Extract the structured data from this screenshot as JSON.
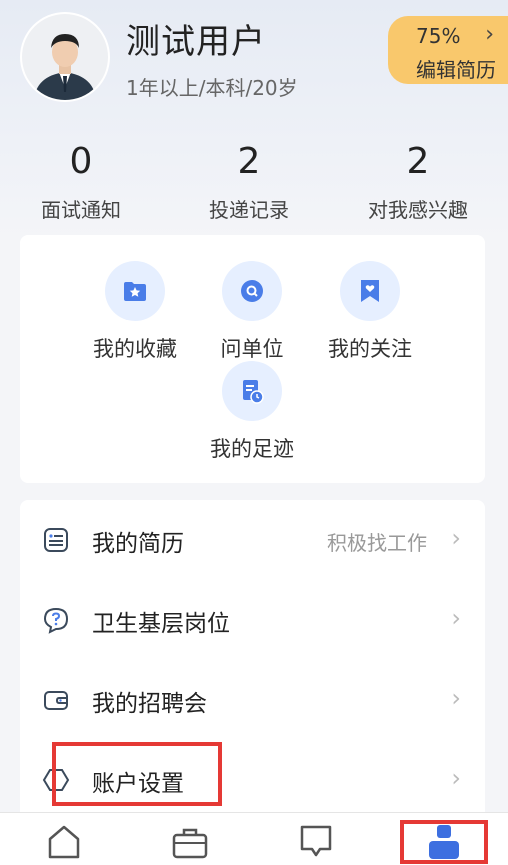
{
  "profile": {
    "name": "测试用户",
    "info": "1年以上/本科/20岁",
    "resume_percent": "75%",
    "resume_edit_label": "编辑简历"
  },
  "stats": [
    {
      "value": "0",
      "label": "面试通知"
    },
    {
      "value": "2",
      "label": "投递记录"
    },
    {
      "value": "2",
      "label": "对我感兴趣"
    }
  ],
  "quick_actions": [
    {
      "label": "我的收藏",
      "icon": "star-folder-icon"
    },
    {
      "label": "问单位",
      "icon": "search-chat-icon"
    },
    {
      "label": "我的关注",
      "icon": "heart-bookmark-icon"
    },
    {
      "label": "我的足迹",
      "icon": "document-clock-icon"
    }
  ],
  "menu": [
    {
      "label": "我的简历",
      "side": "积极找工作",
      "icon": "resume-icon"
    },
    {
      "label": "卫生基层岗位",
      "side": "",
      "icon": "question-icon"
    },
    {
      "label": "我的招聘会",
      "side": "",
      "icon": "wallet-icon"
    },
    {
      "label": "账户设置",
      "side": "",
      "icon": "settings-hex-icon"
    }
  ],
  "colors": {
    "accent": "#4a7de8",
    "badge": "#f9c86c",
    "highlight": "#e53935"
  },
  "tabbar": {
    "tabs": [
      {
        "icon": "home-icon"
      },
      {
        "icon": "briefcase-icon"
      },
      {
        "icon": "message-icon"
      },
      {
        "icon": "profile-icon",
        "active": true
      }
    ]
  }
}
